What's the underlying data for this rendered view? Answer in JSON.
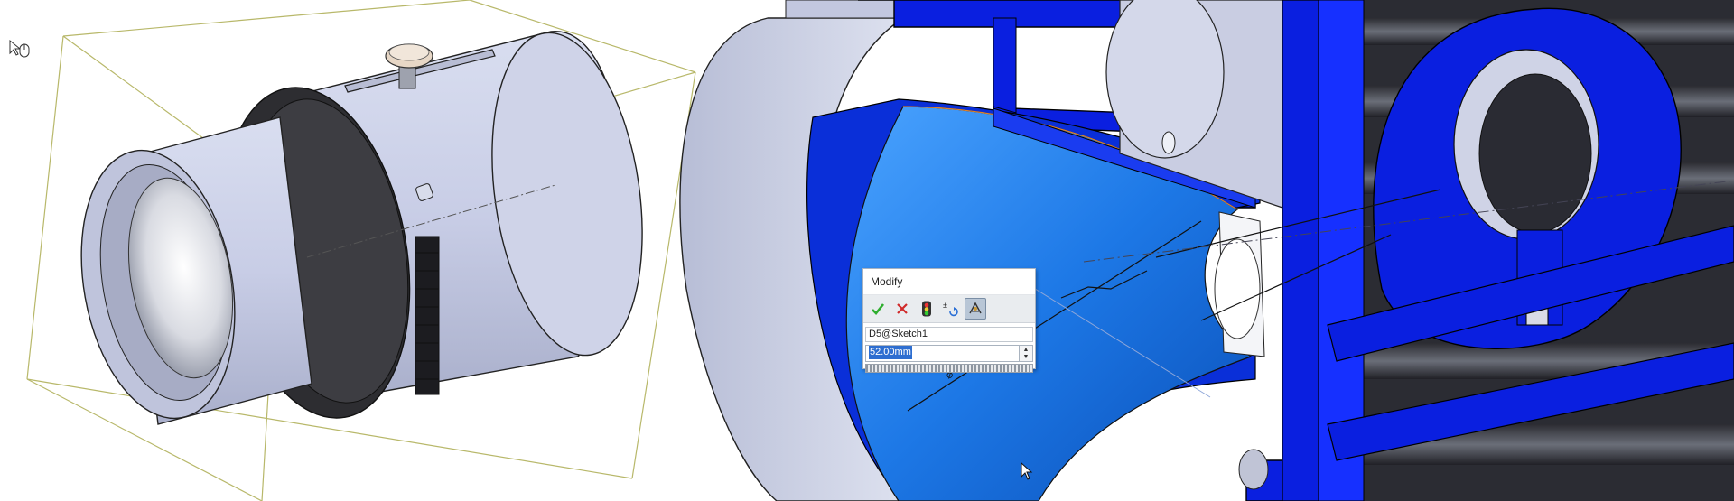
{
  "window": {
    "title": ""
  },
  "modify_dialog": {
    "title": "Modify",
    "dimension_name": "D5@Sketch1",
    "value": "52.00mm",
    "toolbar": {
      "ok_icon": "check-icon",
      "cancel_icon": "x-icon",
      "rebuild_icon": "traffic-light-icon",
      "reverse_icon": "reverse-dimension-icon",
      "mark_icon": "mark-dimension-icon"
    }
  },
  "colors": {
    "section_blue": "#0a1fe0",
    "cone_blue": "#1f7be8",
    "part_gray": "#c9cfe6",
    "bbox_line": "#b8b86a",
    "ok_green": "#2fae2f",
    "cancel_red": "#d02a2a"
  }
}
